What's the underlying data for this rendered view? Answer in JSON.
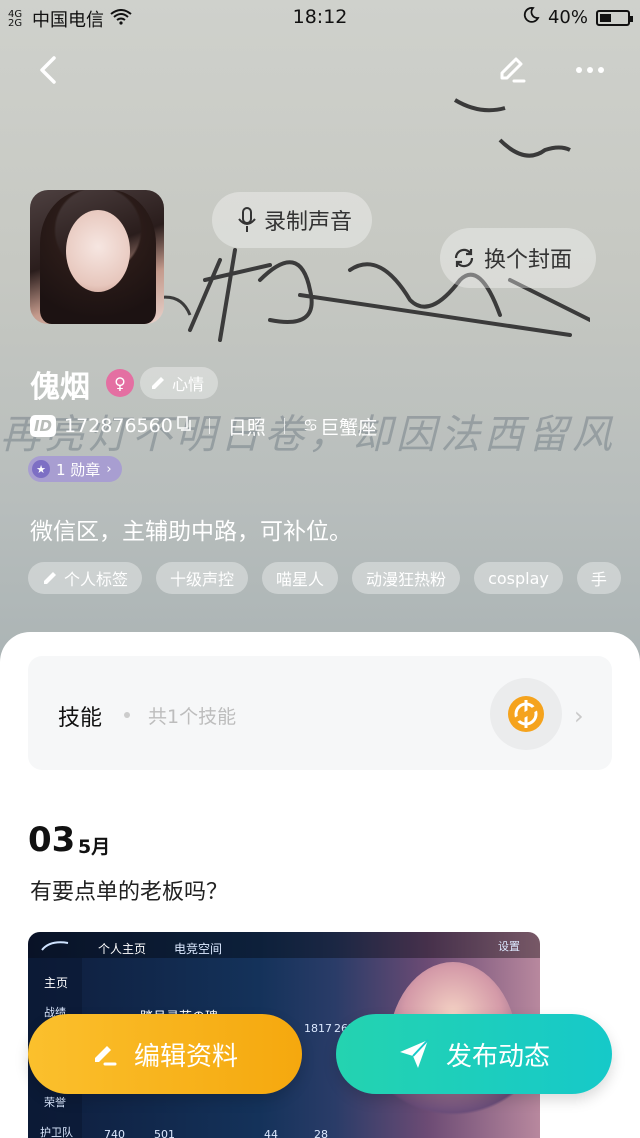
{
  "status_bar": {
    "signal": "4G 2G",
    "carrier": "中国电信",
    "time": "18:12",
    "battery": "40%"
  },
  "header": {
    "icons": [
      "back-icon",
      "edit-icon",
      "more-icon"
    ]
  },
  "profile": {
    "voice_button": "录制声音",
    "change_cover_button": "换个封面",
    "name": "傀烟",
    "gender": "female",
    "mood_button": "心情",
    "id_badge": "ID",
    "id_value": "172876560",
    "photo_label": "日照",
    "zodiac": "巨蟹座",
    "medal_label": "1 勋章",
    "bio": "微信区，主辅助中路，可补位。",
    "tags": [
      "个人标签",
      "十级声控",
      "喵星人",
      "动漫狂热粉",
      "cosplay",
      "手"
    ],
    "cover_watermark": "再亮灯不明日卷，却因法西留风"
  },
  "skills": {
    "title": "技能",
    "count": "共1个技能"
  },
  "post": {
    "day": "03",
    "month": "5月",
    "text": "有要点单的老板吗？",
    "image_texts": {
      "tab_home": "个人主页",
      "tab_esports": "电竞空间",
      "side_home": "主页",
      "side_results": "战绩",
      "side_honor": "荣誉",
      "side_guard": "护卫队",
      "player_name": "踏月寻花の瑰",
      "settings": "设置",
      "stat_1817": "1817",
      "stat_267": "267",
      "stat_740": "740",
      "stat_501": "501",
      "stat_44": "44",
      "stat_28": "28"
    }
  },
  "actions": {
    "edit_profile": "编辑资料",
    "publish": "发布动态"
  },
  "colors": {
    "edit_gradient_start": "#fbc02d",
    "publish_gradient_start": "#24d3b0",
    "gender_badge": "#e46fa2",
    "medal_badge": "#a89ed1",
    "skill_icon": "#f5a31d"
  }
}
